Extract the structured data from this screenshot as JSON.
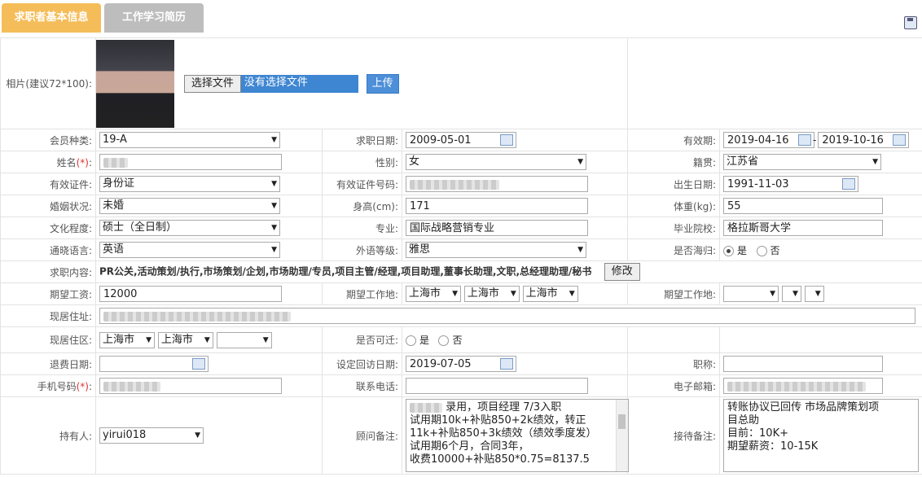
{
  "tabs": [
    "求职者基本信息",
    "工作学习简历"
  ],
  "photo": {
    "label": "相片(建议72*100):",
    "choose_btn": "选择文件",
    "no_file": "没有选择文件",
    "upload_btn": "上传"
  },
  "rows": {
    "member_type": {
      "label": "会员种类:",
      "value": "19-A"
    },
    "apply_date": {
      "label": "求职日期:",
      "value": "2009-05-01"
    },
    "valid_period": {
      "label": "有效期:",
      "from": "2019-04-16",
      "dash": "-",
      "to": "2019-10-16"
    },
    "name": {
      "label": "姓名",
      "req": "(*)",
      "colon": ":"
    },
    "gender": {
      "label": "性别:",
      "value": "女"
    },
    "native": {
      "label": "籍贯:",
      "value": "江苏省"
    },
    "id_type": {
      "label": "有效证件:",
      "value": "身份证"
    },
    "id_no": {
      "label": "有效证件号码:"
    },
    "birth": {
      "label": "出生日期:",
      "value": "1991-11-03"
    },
    "marital": {
      "label": "婚姻状况:",
      "value": "未婚"
    },
    "height": {
      "label": "身高(cm):",
      "value": "171"
    },
    "weight": {
      "label": "体重(kg):",
      "value": "55"
    },
    "education": {
      "label": "文化程度:",
      "value": "硕士（全日制）"
    },
    "major": {
      "label": "专业:",
      "value": "国际战略营销专业"
    },
    "school": {
      "label": "毕业院校:",
      "value": "格拉斯哥大学"
    },
    "language": {
      "label": "通晓语言:",
      "value": "英语"
    },
    "lang_level": {
      "label": "外语等级:",
      "value": "雅思"
    },
    "overseas": {
      "label": "是否海归:",
      "yes": "是",
      "no": "否"
    },
    "job_content": {
      "label": "求职内容:",
      "value": "PR公关,活动策划/执行,市场策划/企划,市场助理/专员,项目主管/经理,项目助理,董事长助理,文职,总经理助理/秘书",
      "edit_btn": "修改"
    },
    "salary": {
      "label": "期望工资:",
      "value": "12000"
    },
    "work_place1": {
      "label": "期望工作地:",
      "v1": "上海市",
      "v2": "上海市",
      "v3": "上海市"
    },
    "work_place2": {
      "label": "期望工作地:"
    },
    "address": {
      "label": "现居住址:"
    },
    "district": {
      "label": "现居住区:",
      "v1": "上海市",
      "v2": "上海市"
    },
    "relocate": {
      "label": "是否可迁:",
      "yes": "是",
      "no": "否"
    },
    "refund_date": {
      "label": "退费日期:"
    },
    "visit_date": {
      "label": "设定回访日期:",
      "value": "2019-07-05"
    },
    "title": {
      "label": "职称:"
    },
    "mobile": {
      "label": "手机号码",
      "req": "(*)",
      "colon": ":"
    },
    "phone": {
      "label": "联系电话:"
    },
    "email": {
      "label": "电子邮箱:"
    },
    "holder": {
      "label": "持有人:",
      "value": "yirui018"
    },
    "consultant_note": {
      "label": "顾问备注:",
      "lines": [
        "录用，项目经理 7/3入职",
        "试用期10k+补贴850+2k绩效，转正",
        "11k+补贴850+3k绩效（绩效季度发）",
        "试用期6个月，合同3年，",
        "收费10000+补贴850*0.75=8137.5"
      ]
    },
    "reception_note": {
      "label": "接待备注:",
      "lines": [
        "转账协议已回传  市场品牌策划项",
        "目总助",
        "目前：10K+",
        "期望薪资：10-15K"
      ]
    }
  }
}
